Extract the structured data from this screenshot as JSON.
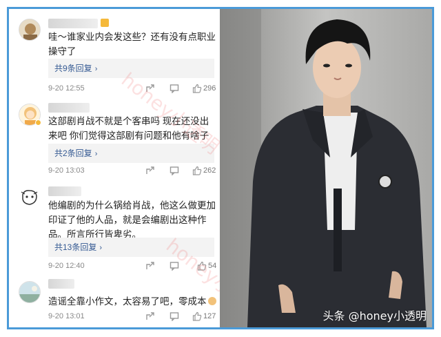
{
  "comments": [
    {
      "text": "哇～谁家业内会发这些？还有没有点职业操守了",
      "replies_label": "共9条回复",
      "date": "9-20 12:55",
      "likes": "296"
    },
    {
      "text": "这部剧肖战不就是个客串吗 现在还没出来吧 你们觉得这部剧有问题和他有啥子关系",
      "replies_label": "共2条回复",
      "date": "9-20 13:03",
      "likes": "262"
    },
    {
      "text": "他编剧的为什么锅给肖战，他这么做更加印证了他的人品，就是会编剧出这种作品。所言所行皆卑劣。",
      "replies_label": "共13条回复",
      "date": "9-20 12:40",
      "likes": "54"
    },
    {
      "text": "造谣全靠小作文，太容易了吧，零成本",
      "date": "9-20 13:01",
      "likes": "127"
    }
  ],
  "watermark": "honey小透明",
  "brand_text": "头条 @honey小透明",
  "colors": {
    "border": "#4a9ad8",
    "reply_link": "#355a93",
    "reply_bg": "#f3f3f3"
  },
  "icons": [
    "share-icon",
    "comment-icon",
    "thumbs-up-icon",
    "chevron-right-icon"
  ]
}
